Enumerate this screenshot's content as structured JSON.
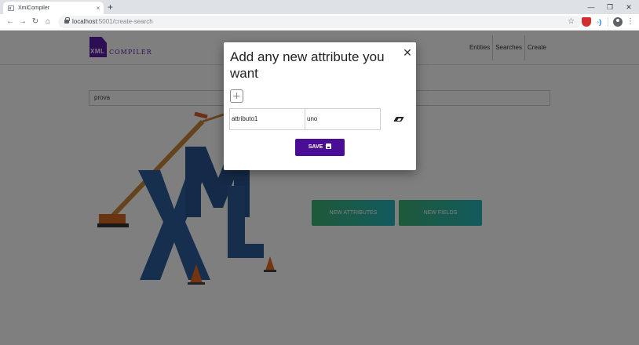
{
  "browser": {
    "tab_title": "XmlCompiler",
    "tab_close": "×",
    "new_tab": "+",
    "url_host": "localhost",
    "url_path": ":5001/create-search",
    "window_controls": [
      "—",
      "❐",
      "✕"
    ]
  },
  "navbar": {
    "logo_mark": "XML",
    "logo_word": "COMPILER",
    "links": [
      "Entities",
      "Searches",
      "Create"
    ]
  },
  "search": {
    "value": "prova"
  },
  "hero": {
    "letters": [
      "X",
      "M",
      "L"
    ]
  },
  "actions": {
    "new_attributes": "NEW ATTRIBUTES",
    "new_fields": "NEW FIELDS"
  },
  "modal": {
    "title": "Add any new attribute you want",
    "close": "✕",
    "attribute_name": "attributo1",
    "attribute_value": "uno",
    "save_label": "SAVE"
  },
  "colors": {
    "brand": "#5b1ca8",
    "save_button": "#4a0d96",
    "action_gradient_start": "#3cb371",
    "action_gradient_end": "#26b4bd"
  }
}
